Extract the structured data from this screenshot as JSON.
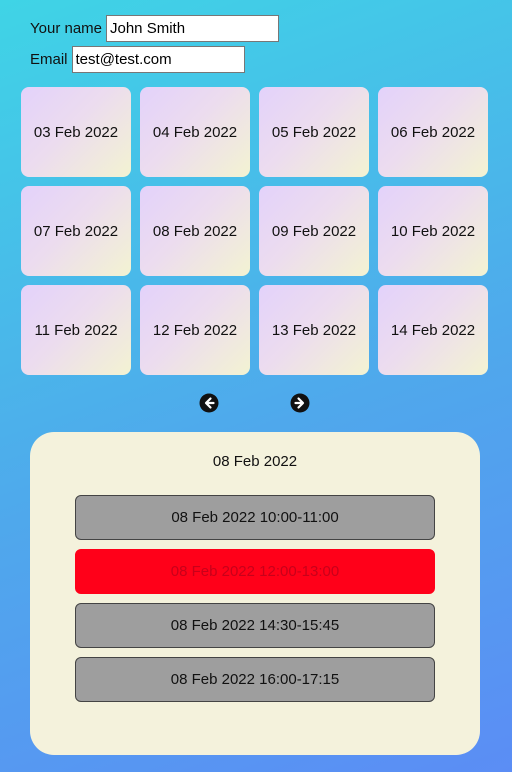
{
  "form": {
    "name_label": "Your name",
    "name_value": "John Smith",
    "email_label": "Email",
    "email_value": "test@test.com"
  },
  "dates": [
    {
      "label": "03 Feb 2022"
    },
    {
      "label": "04 Feb 2022"
    },
    {
      "label": "05 Feb 2022"
    },
    {
      "label": "06 Feb 2022"
    },
    {
      "label": "07 Feb 2022"
    },
    {
      "label": "08 Feb 2022"
    },
    {
      "label": "09 Feb 2022"
    },
    {
      "label": "10 Feb 2022"
    },
    {
      "label": "11 Feb 2022"
    },
    {
      "label": "12 Feb 2022"
    },
    {
      "label": "13 Feb 2022"
    },
    {
      "label": "14 Feb 2022"
    }
  ],
  "navigation": {
    "prev_icon": "arrow-left-circle-icon",
    "next_icon": "arrow-right-circle-icon"
  },
  "panel": {
    "title": "08 Feb 2022",
    "slots": [
      {
        "label": "08 Feb 2022 10:00-11:00",
        "status": "available"
      },
      {
        "label": "08 Feb 2022 12:00-13:00",
        "status": "booked"
      },
      {
        "label": "08 Feb 2022 14:30-15:45",
        "status": "available"
      },
      {
        "label": "08 Feb 2022 16:00-17:15",
        "status": "available"
      }
    ]
  },
  "colors": {
    "background_start": "#3fd4e6",
    "background_end": "#5b8df5",
    "slot_available": "#9e9e9e",
    "slot_booked": "#ff0019",
    "panel_background": "#f4f2dc"
  }
}
